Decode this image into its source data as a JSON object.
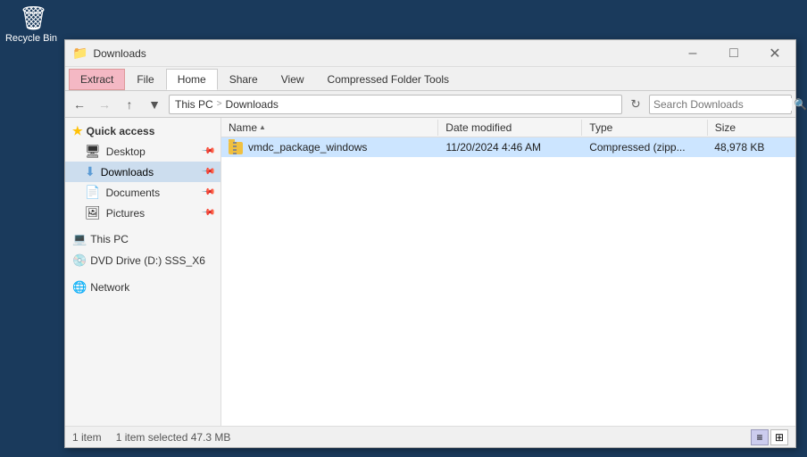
{
  "desktop": {
    "recycle_bin_label": "Recycle Bin"
  },
  "window": {
    "title": "Downloads",
    "tabs": [
      {
        "id": "extract",
        "label": "Extract",
        "active": false,
        "highlight": true
      },
      {
        "id": "file",
        "label": "File",
        "active": false
      },
      {
        "id": "home",
        "label": "Home",
        "active": true
      },
      {
        "id": "share",
        "label": "Share",
        "active": false
      },
      {
        "id": "view",
        "label": "View",
        "active": false
      },
      {
        "id": "compressed",
        "label": "Compressed Folder Tools",
        "active": false
      }
    ],
    "minimize_label": "–",
    "maximize_label": "□",
    "close_label": "✕"
  },
  "addressbar": {
    "back_tooltip": "Back",
    "forward_tooltip": "Forward",
    "up_tooltip": "Up",
    "path_parts": [
      "This PC",
      "Downloads"
    ],
    "search_placeholder": "Search Downloads",
    "refresh_tooltip": "Refresh"
  },
  "sidebar": {
    "quick_access_label": "Quick access",
    "items": [
      {
        "id": "desktop",
        "label": "Desktop",
        "pinned": true
      },
      {
        "id": "downloads",
        "label": "Downloads",
        "pinned": true,
        "active": true
      },
      {
        "id": "documents",
        "label": "Documents",
        "pinned": true
      },
      {
        "id": "pictures",
        "label": "Pictures",
        "pinned": true
      }
    ],
    "this_pc_label": "This PC",
    "dvd_drive_label": "DVD Drive (D:) SSS_X6",
    "network_label": "Network"
  },
  "filelist": {
    "columns": [
      {
        "id": "name",
        "label": "Name",
        "sort": "asc"
      },
      {
        "id": "date",
        "label": "Date modified"
      },
      {
        "id": "type",
        "label": "Type"
      },
      {
        "id": "size",
        "label": "Size"
      }
    ],
    "files": [
      {
        "name": "vmdc_package_windows",
        "date_modified": "11/20/2024 4:46 AM",
        "type": "Compressed (zipp...",
        "size": "48,978 KB",
        "selected": true
      }
    ]
  },
  "statusbar": {
    "item_count": "1 item",
    "selection_info": "1 item selected  47.3 MB",
    "view_details_label": "≡",
    "view_tiles_label": "⊞"
  }
}
